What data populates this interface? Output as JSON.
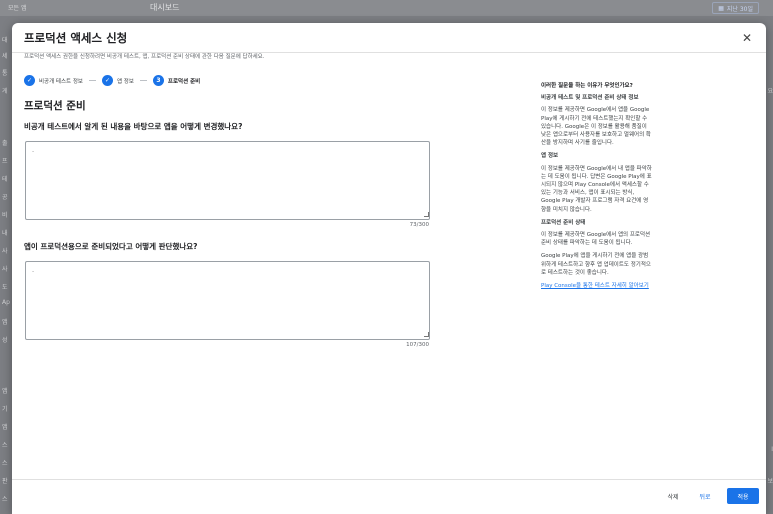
{
  "background": {
    "top_left_label": "모든 앱",
    "page_title": "대시보드",
    "date_range": "지난 30일",
    "sidebar_fragments": [
      "대",
      "세",
      "통",
      "게",
      "출",
      "프",
      "테",
      "공",
      "비",
      "내",
      "사",
      "사",
      "도",
      "Ap",
      "앱",
      "성",
      "앱",
      "기",
      "앱",
      "스",
      "스",
      "판",
      "스"
    ],
    "right_fragments": [
      "요",
      "I",
      "보"
    ]
  },
  "dialog": {
    "title": "프로덕션 액세스 신청",
    "intro": "프로덕션 액세스 권한을 신청하려면 비공개 테스트, 앱, 프로덕션 준비 상태에 관한 다음 질문에 답하세요.",
    "steps": [
      {
        "label": "비공개 테스트 정보",
        "state": "done"
      },
      {
        "label": "앱 정보",
        "state": "done"
      },
      {
        "number": "3",
        "label": "프로덕션 준비",
        "state": "current"
      }
    ],
    "section_title": "프로덕션 준비",
    "question1": {
      "label": "비공개 테스트에서 알게 된 내용을 바탕으로 앱을 어떻게 변경했나요?",
      "value": "-",
      "counter": "73/300"
    },
    "question2": {
      "label": "앱이 프로덕션용으로 준비되었다고 어떻게 판단했나요?",
      "value": "-",
      "counter": "107/300"
    },
    "info": {
      "question": "이러한 질문을 하는 이유가 무엇인가요?",
      "h1": "비공개 테스트 및 프로덕션 준비 상태 정보",
      "p1": "이 정보를 제공하면 Google에서 앱을 Google Play에 게시하기 전에 테스트했는지 확인할 수 있습니다. Google은 이 정보를 활용해 품질이 낮은 앱으로부터 사용자를 보호하고 멀웨어의 확산을 방지하며 사기를 줄입니다.",
      "h2": "앱 정보",
      "p2": "이 정보를 제공하면 Google에서 내 앱을 파악하는 데 도움이 됩니다. 답변은 Google Play에 표시되지 않으며 Play Console에서 액세스할 수 있는 기능과 서비스, 앱이 표시되는 방식, Google Play 개발자 프로그램 자격 요건에 영향을 미치지 않습니다.",
      "h3": "프로덕션 준비 상태",
      "p3": "이 정보를 제공하면 Google에서 앱의 프로덕션 준비 상태를 파악하는 데 도움이 됩니다.",
      "p4": "Google Play에 앱을 게시하기 전에 앱을 광범위하게 테스트하고 향후 앱 업데이트도 정기적으로 테스트하는 것이 좋습니다.",
      "link": "Play Console을 통한 테스트 자세히 알아보기"
    },
    "footer": {
      "delete": "삭제",
      "back": "뒤로",
      "apply": "적용"
    }
  },
  "colors": {
    "accent": "#1a73e8",
    "overlay": "#7c7e83"
  }
}
